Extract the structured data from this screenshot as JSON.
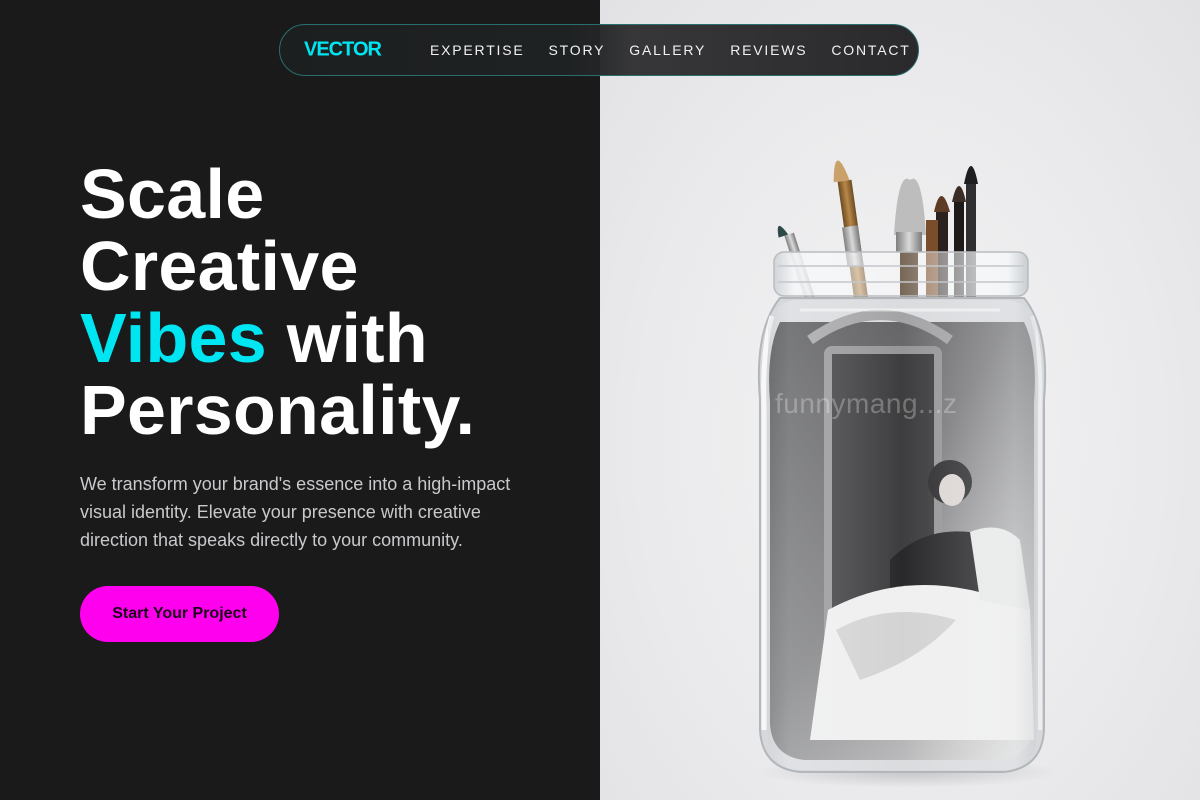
{
  "brand": {
    "name": "VECTOR",
    "accent_color": "#00e5f2"
  },
  "nav": {
    "links": [
      {
        "label": "EXPERTISE"
      },
      {
        "label": "STORY"
      },
      {
        "label": "GALLERY"
      },
      {
        "label": "REVIEWS"
      },
      {
        "label": "CONTACT"
      }
    ]
  },
  "hero": {
    "headline": {
      "line1": "Scale",
      "line2": "Creative",
      "line3_accent": "Vibes",
      "line3_rest": " with",
      "line4": "Personality."
    },
    "subtext": "We transform your brand's essence into a high-impact visual identity. Elevate your presence with creative direction that speaks directly to your community.",
    "cta_label": "Start Your Project",
    "cta_color": "#ff00ee"
  },
  "image": {
    "watermark": "funnymang...z",
    "icon": "jar-with-paintbrushes-photo"
  }
}
